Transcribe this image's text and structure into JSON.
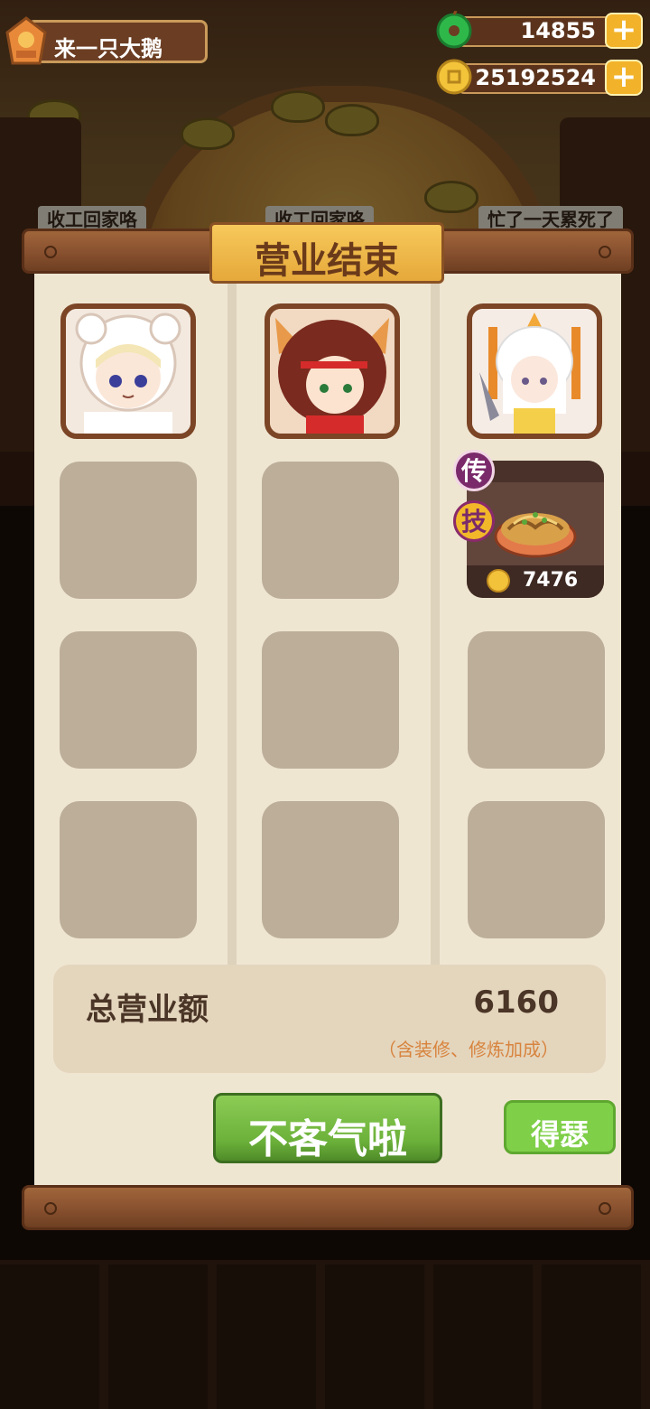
{
  "hud": {
    "player_name": "来一只大鹅",
    "jade_amount": "14855",
    "coin_amount": "25192524",
    "add_symbol": "+"
  },
  "background": {
    "bubbles": [
      "收工回家咯",
      "收工回家咯",
      "忙了一天累死了"
    ]
  },
  "panel": {
    "title": "营业结束",
    "dish": {
      "tag_legend": "传",
      "tag_skill": "技",
      "price": "7476"
    },
    "total_label": "总营业额",
    "total_value": "6160",
    "total_note": "（含装修、修炼加成）",
    "confirm_button": "不客气啦",
    "share_button": "得瑟"
  },
  "colors": {
    "accent_green": "#6cb13a",
    "gold": "#f2b32a",
    "wood": "#8a5230",
    "paper": "#efe6d2",
    "note_orange": "#d8843e"
  }
}
